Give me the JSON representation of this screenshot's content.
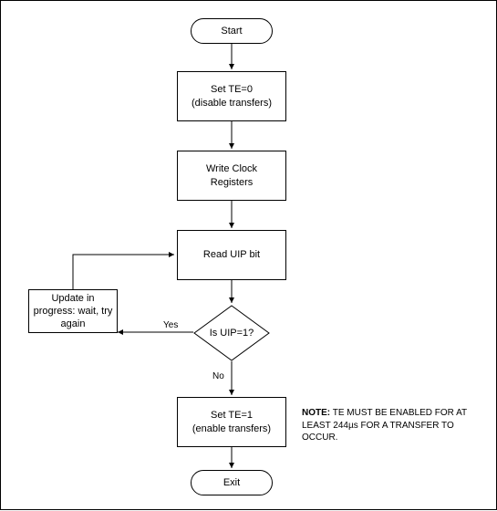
{
  "flow": {
    "start": "Start",
    "step1_line1": "Set TE=0",
    "step1_line2": "(disable transfers)",
    "step2_line1": "Write Clock",
    "step2_line2": "Registers",
    "step3": "Read UIP bit",
    "update_line1": "Update in",
    "update_line2": "progress: wait, try",
    "update_line3": "again",
    "decision": "Is UIP=1?",
    "edge_yes": "Yes",
    "edge_no": "No",
    "step4_line1": "Set TE=1",
    "step4_line2": "(enable transfers)",
    "exit": "Exit"
  },
  "note": {
    "prefix": "NOTE:",
    "body": " TE MUST BE ENABLED FOR AT LEAST 244µs FOR A TRANSFER TO OCCUR."
  }
}
